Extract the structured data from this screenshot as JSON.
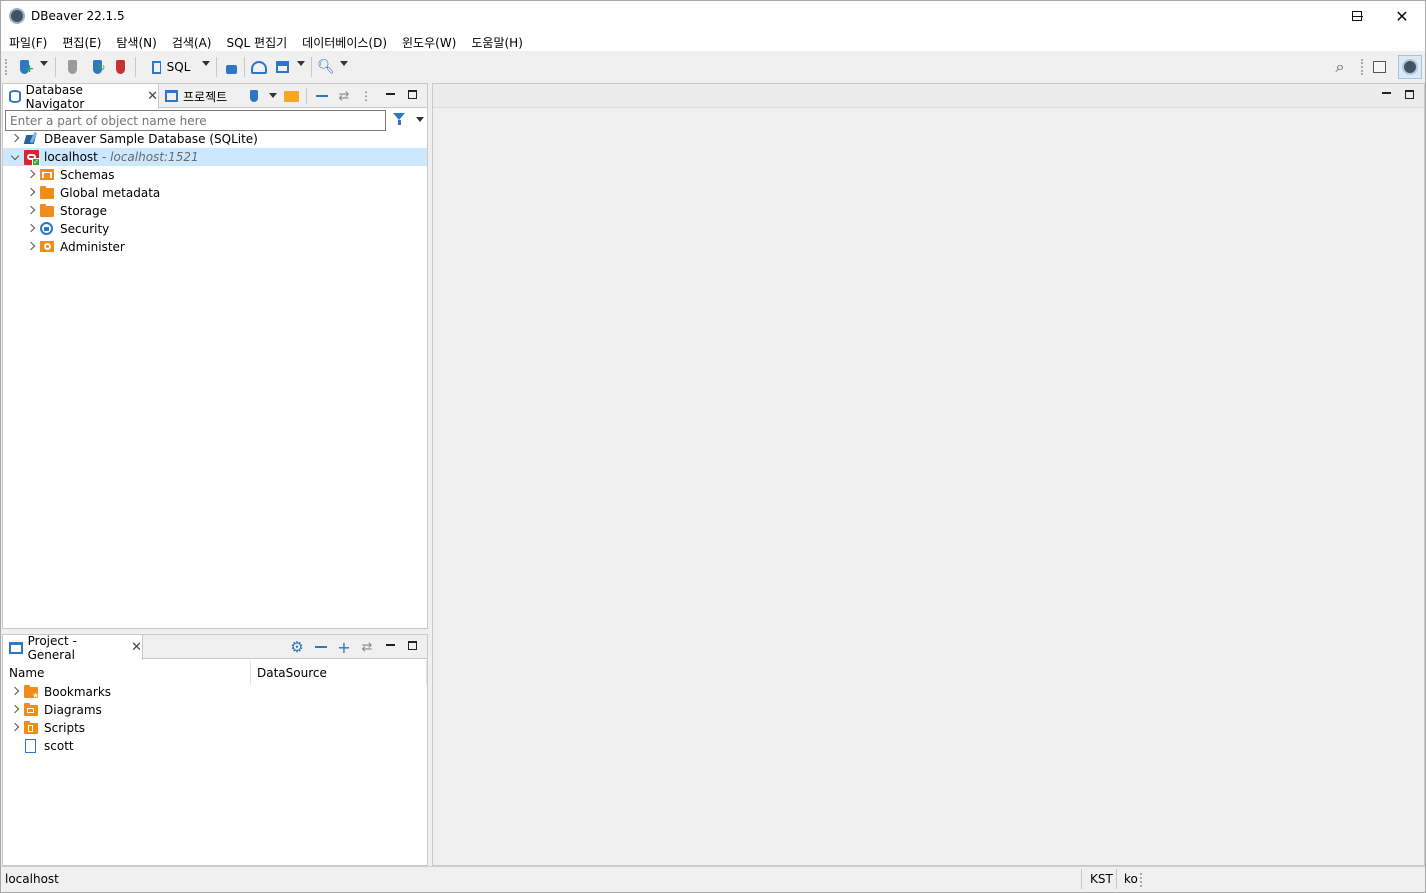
{
  "window": {
    "title": "DBeaver 22.1.5"
  },
  "menu": [
    "파일(F)",
    "편집(E)",
    "탐색(N)",
    "검색(A)",
    "SQL 편집기",
    "데이터베이스(D)",
    "윈도우(W)",
    "도움말(H)"
  ],
  "toolbar": {
    "sql_label": "SQL"
  },
  "navigator": {
    "tab_label": "Database Navigator",
    "projects_tab_label": "프로젝트",
    "filter_placeholder": "Enter a part of object name here",
    "tree": [
      {
        "label": "DBeaver Sample Database (SQLite)",
        "expanded": false
      },
      {
        "label": "localhost",
        "detail": "- localhost:1521",
        "expanded": true,
        "selected": true
      },
      {
        "label": "Schemas",
        "icon": "schemas-icon"
      },
      {
        "label": "Global metadata",
        "icon": "folder-icon"
      },
      {
        "label": "Storage",
        "icon": "folder-icon"
      },
      {
        "label": "Security",
        "icon": "security-icon"
      },
      {
        "label": "Administer",
        "icon": "administer-icon"
      }
    ]
  },
  "project": {
    "tab_label": "Project - General",
    "columns": [
      "Name",
      "DataSource"
    ],
    "items": [
      "Bookmarks",
      "Diagrams",
      "Scripts",
      "scott"
    ]
  },
  "status": {
    "connection": "localhost",
    "timezone": "KST",
    "locale": "ko"
  },
  "colors": {
    "accent": "#2d77c6",
    "folder": "#f18c16",
    "selection": "#cce8ff",
    "oracle_red": "#d9242b"
  }
}
